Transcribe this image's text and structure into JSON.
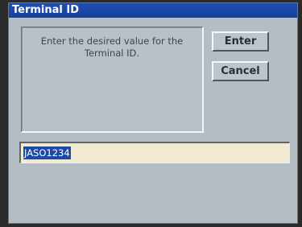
{
  "window": {
    "title": "Terminal ID"
  },
  "dialog": {
    "message": "Enter the desired value for the Terminal ID."
  },
  "buttons": {
    "enter_label": "Enter",
    "cancel_label": "Cancel"
  },
  "input": {
    "value": "JASO1234",
    "selected": true
  },
  "colors": {
    "titlebar": "#1a47a8",
    "dialog_background": "#b4bdc4",
    "input_background": "#f1ebd2",
    "selection": "#1d4aa8"
  }
}
